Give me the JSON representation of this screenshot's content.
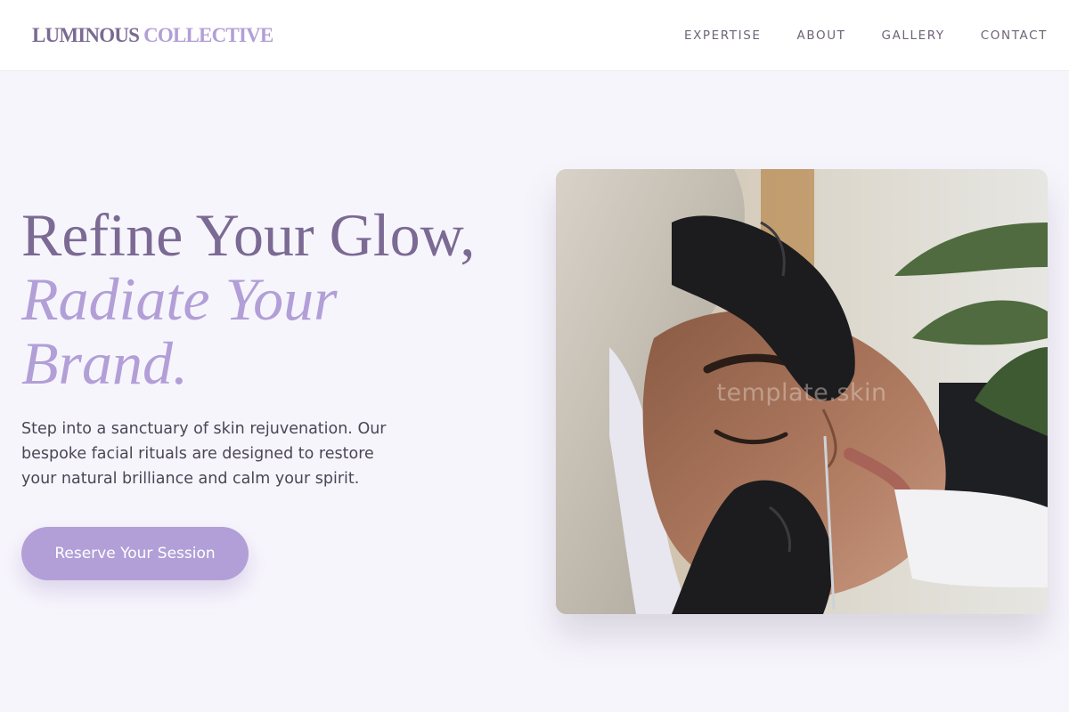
{
  "brand": {
    "part1": "LUMINOUS",
    "part2": "COLLECTIVE"
  },
  "nav": {
    "items": [
      "EXPERTISE",
      "ABOUT",
      "GALLERY",
      "CONTACT"
    ]
  },
  "hero": {
    "title_line1": "Refine Your Glow,",
    "title_line2": "Radiate Your Brand.",
    "description": "Step into a sanctuary of skin rejuvenation. Our bespoke facial rituals are designed to restore your natural brilliance and calm your spirit.",
    "cta_label": "Reserve Your Session"
  },
  "image": {
    "watermark": "template.skin",
    "subject": "facial-treatment-photo"
  },
  "colors": {
    "accent": "#b29fd7",
    "brand_dark": "#7b6a93",
    "background": "#f7f5fc",
    "header_bg": "#ffffff"
  }
}
